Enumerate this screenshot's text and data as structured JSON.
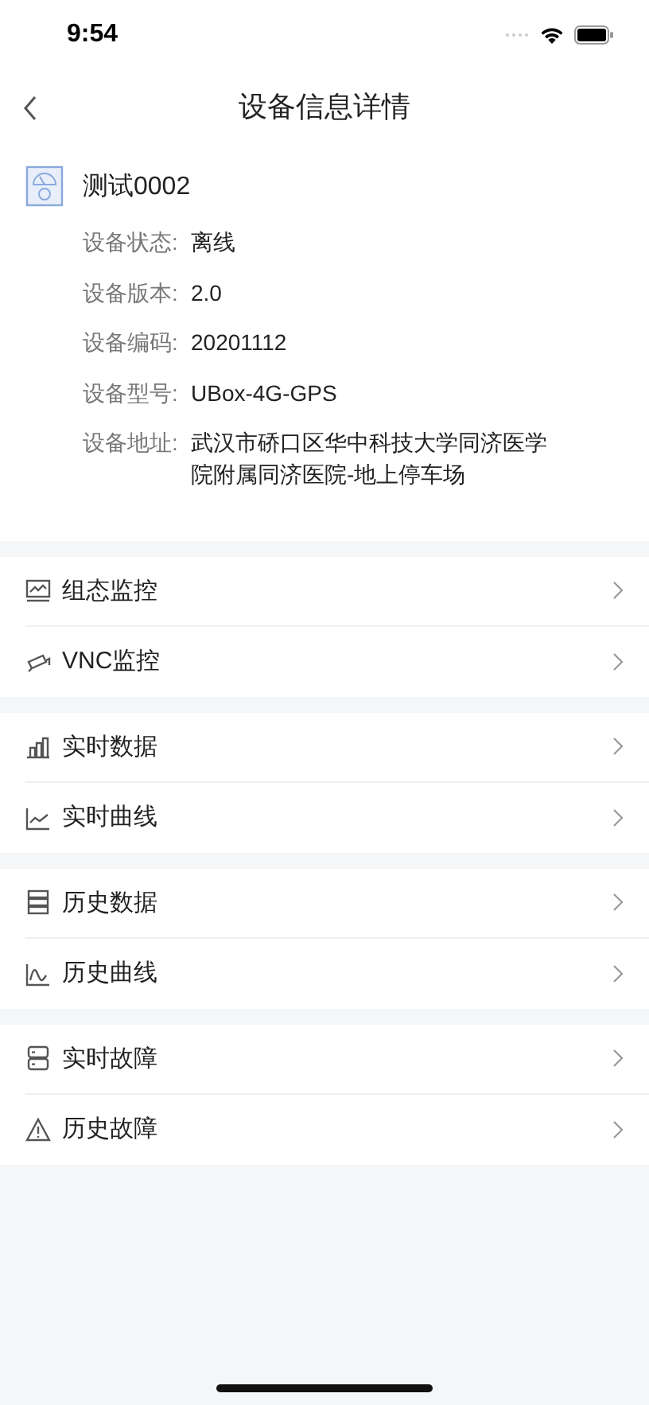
{
  "status_bar": {
    "time": "9:54"
  },
  "nav": {
    "title": "设备信息详情"
  },
  "device": {
    "name": "测试0002",
    "fields": [
      {
        "label": "设备状态:",
        "value": "离线"
      },
      {
        "label": "设备版本:",
        "value": "2.0"
      },
      {
        "label": "设备编码:",
        "value": "20201112"
      },
      {
        "label": "设备型号:",
        "value": "UBox-4G-GPS"
      },
      {
        "label": "设备地址:",
        "value": "武汉市硚口区华中科技大学同济医学院附属同济医院-地上停车场"
      }
    ]
  },
  "groups": [
    [
      {
        "label": "组态监控",
        "kind": "monitor"
      },
      {
        "label": "VNC监控",
        "kind": "camera"
      }
    ],
    [
      {
        "label": "实时数据",
        "kind": "bars"
      },
      {
        "label": "实时曲线",
        "kind": "line"
      }
    ],
    [
      {
        "label": "历史数据",
        "kind": "list"
      },
      {
        "label": "历史曲线",
        "kind": "curve"
      }
    ],
    [
      {
        "label": "实时故障",
        "kind": "server"
      },
      {
        "label": "历史故障",
        "kind": "warning"
      }
    ]
  ]
}
